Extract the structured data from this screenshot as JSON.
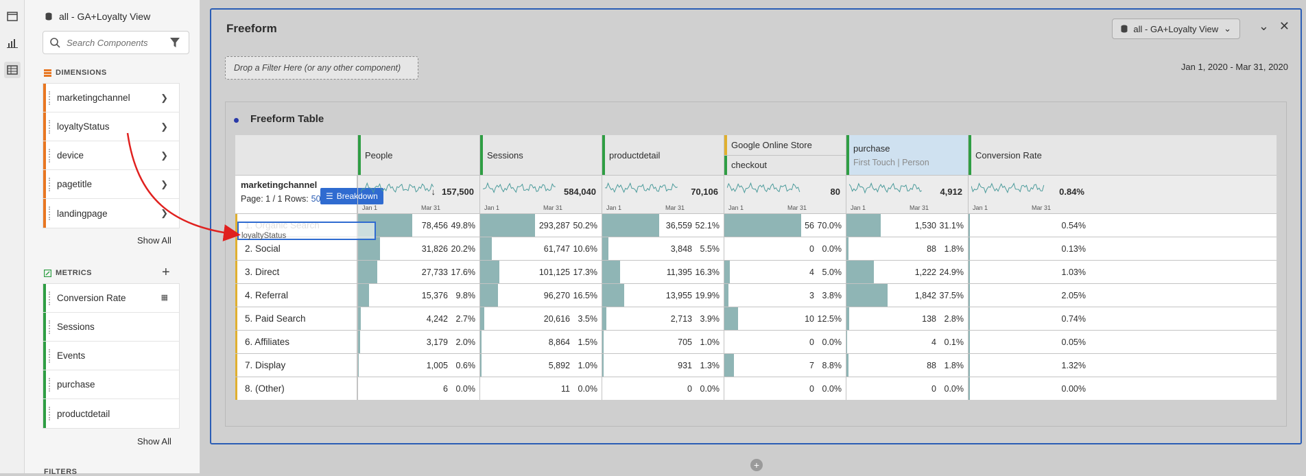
{
  "rail": {
    "icons": [
      "panel-icon",
      "visualization-icon",
      "components-icon"
    ]
  },
  "panel": {
    "datasource": "all - GA+Loyalty View",
    "search_placeholder": "Search Components",
    "dimensions_heading": "DIMENSIONS",
    "dimensions": [
      "marketingchannel",
      "loyaltyStatus",
      "device",
      "pagetitle",
      "landingpage"
    ],
    "dimensions_showall": "Show All",
    "metrics_heading": "METRICS",
    "metrics": [
      "Conversion Rate",
      "Sessions",
      "Events",
      "purchase",
      "productdetail"
    ],
    "metrics_showall": "Show All",
    "filters_heading": "FILTERS"
  },
  "workspace": {
    "panel_title": "Freeform",
    "datasource_select": "all - GA+Loyalty View",
    "drop_filter": "Drop a Filter Here (or any other component)",
    "date_range": "Jan 1, 2020 - Mar 31, 2020",
    "table_title": "Freeform Table",
    "dimension": "marketingchannel",
    "page_info": "Page: 1 / 1  Rows:",
    "rows_value": "50",
    "breakdown_label": "Breakdown",
    "drag_label": "loyaltyStatus",
    "columns": [
      {
        "name": "People",
        "color": "#2f9e44"
      },
      {
        "name": "Sessions",
        "color": "#2f9e44"
      },
      {
        "name": "productdetail",
        "color": "#2f9e44"
      },
      {
        "name": "Google Online Store",
        "sub": "checkout",
        "color": "#e0b030"
      },
      {
        "name": "purchase",
        "sub": "First Touch | Person",
        "color": "#2f9e44"
      },
      {
        "name": "Conversion Rate",
        "color": "#2f9e44"
      }
    ],
    "totals": [
      "157,500",
      "584,040",
      "70,106",
      "80",
      "4,912",
      "0.84%"
    ],
    "spark_start": "Jan 1",
    "spark_end": "Mar 31",
    "rows": [
      {
        "label": "1. Organic Search",
        "cells": [
          [
            "78,456",
            "49.8%",
            0.498
          ],
          [
            "293,287",
            "50.2%",
            0.502
          ],
          [
            "36,559",
            "52.1%",
            0.521
          ],
          [
            "56",
            "70.0%",
            0.7
          ],
          [
            "1,530",
            "31.1%",
            0.311
          ],
          [
            "0.54%"
          ]
        ]
      },
      {
        "label": "2. Social",
        "cells": [
          [
            "31,826",
            "20.2%",
            0.202
          ],
          [
            "61,747",
            "10.6%",
            0.106
          ],
          [
            "3,848",
            "5.5%",
            0.055
          ],
          [
            "0",
            "0.0%",
            0
          ],
          [
            "88",
            "1.8%",
            0.018
          ],
          [
            "0.13%"
          ]
        ]
      },
      {
        "label": "3. Direct",
        "cells": [
          [
            "27,733",
            "17.6%",
            0.176
          ],
          [
            "101,125",
            "17.3%",
            0.173
          ],
          [
            "11,395",
            "16.3%",
            0.163
          ],
          [
            "4",
            "5.0%",
            0.05
          ],
          [
            "1,222",
            "24.9%",
            0.249
          ],
          [
            "1.03%"
          ]
        ]
      },
      {
        "label": "4. Referral",
        "cells": [
          [
            "15,376",
            "9.8%",
            0.098
          ],
          [
            "96,270",
            "16.5%",
            0.165
          ],
          [
            "13,955",
            "19.9%",
            0.199
          ],
          [
            "3",
            "3.8%",
            0.038
          ],
          [
            "1,842",
            "37.5%",
            0.375
          ],
          [
            "2.05%"
          ]
        ]
      },
      {
        "label": "5. Paid Search",
        "cells": [
          [
            "4,242",
            "2.7%",
            0.027
          ],
          [
            "20,616",
            "3.5%",
            0.035
          ],
          [
            "2,713",
            "3.9%",
            0.039
          ],
          [
            "10",
            "12.5%",
            0.125
          ],
          [
            "138",
            "2.8%",
            0.028
          ],
          [
            "0.74%"
          ]
        ]
      },
      {
        "label": "6. Affiliates",
        "cells": [
          [
            "3,179",
            "2.0%",
            0.02
          ],
          [
            "8,864",
            "1.5%",
            0.015
          ],
          [
            "705",
            "1.0%",
            0.01
          ],
          [
            "0",
            "0.0%",
            0
          ],
          [
            "4",
            "0.1%",
            0.001
          ],
          [
            "0.05%"
          ]
        ]
      },
      {
        "label": "7. Display",
        "cells": [
          [
            "1,005",
            "0.6%",
            0.006
          ],
          [
            "5,892",
            "1.0%",
            0.01
          ],
          [
            "931",
            "1.3%",
            0.013
          ],
          [
            "7",
            "8.8%",
            0.088
          ],
          [
            "88",
            "1.8%",
            0.018
          ],
          [
            "1.32%"
          ]
        ]
      },
      {
        "label": "8. (Other)",
        "cells": [
          [
            "6",
            "0.0%",
            0
          ],
          [
            "11",
            "0.0%",
            0
          ],
          [
            "0",
            "0.0%",
            0
          ],
          [
            "0",
            "0.0%",
            0
          ],
          [
            "0",
            "0.0%",
            0
          ],
          [
            "0.00%"
          ]
        ]
      }
    ]
  },
  "colors": {
    "dimension_bar": "#e87722",
    "metric_bar": "#2f9e44",
    "accent": "#2f6bd0",
    "bar_fill": "#8fb5b5"
  }
}
